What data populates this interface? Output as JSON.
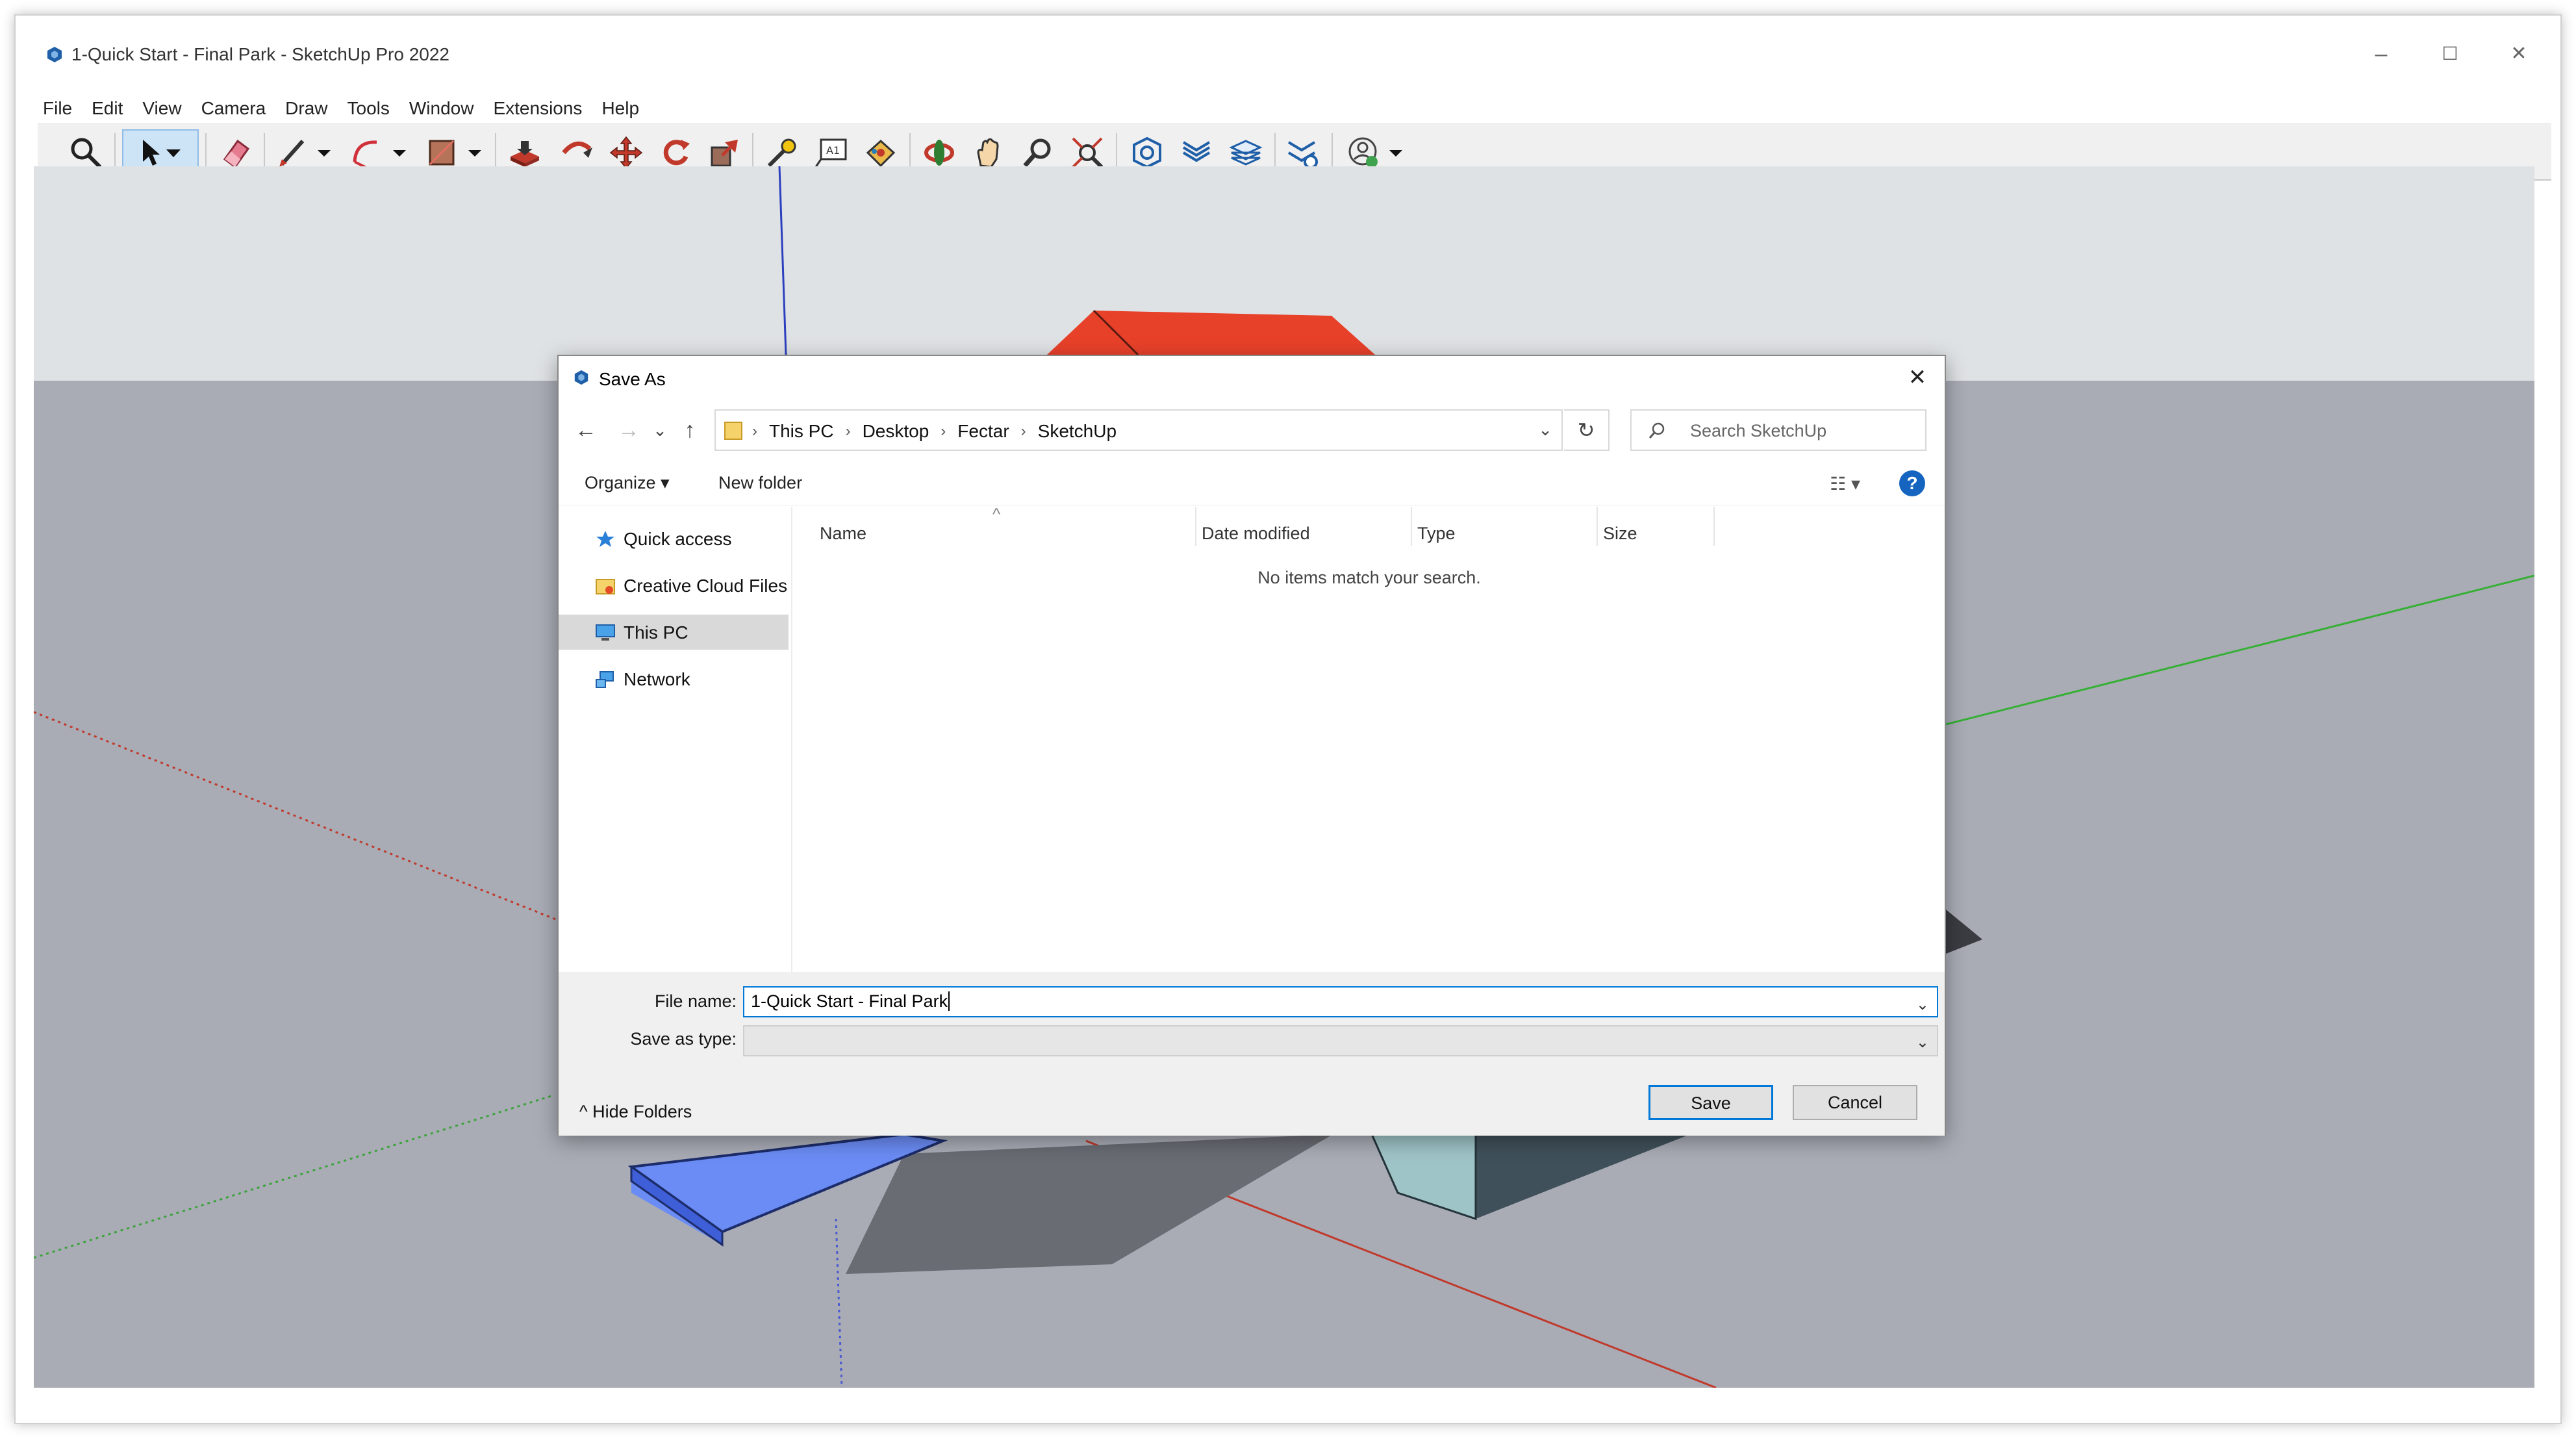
{
  "window": {
    "title": "1-Quick Start - Final Park - SketchUp Pro 2022",
    "controls": {
      "minimize": "–",
      "maximize": "☐",
      "close": "✕"
    }
  },
  "menubar": [
    "File",
    "Edit",
    "View",
    "Camera",
    "Draw",
    "Tools",
    "Window",
    "Extensions",
    "Help"
  ],
  "toolbar": {
    "tools": [
      "search-icon",
      "select-icon",
      "eraser-icon",
      "pencil-icon",
      "arc-icon",
      "rectangle-icon",
      "push-pull-icon",
      "follow-me-icon",
      "move-icon",
      "rotate-icon",
      "scale-icon",
      "tape-measure-icon",
      "text-icon",
      "paint-bucket-icon",
      "orbit-icon",
      "pan-icon",
      "zoom-icon",
      "zoom-extents-icon",
      "warehouse-icon",
      "extension-warehouse-icon",
      "layout-icon",
      "extension-manager-icon",
      "account-icon"
    ],
    "accent": "#cde4f7"
  },
  "dialog": {
    "title": "Save As",
    "close": "✕",
    "nav": {
      "back": "←",
      "forward": "→",
      "recent": "⌄",
      "up": "↑"
    },
    "breadcrumbs": [
      "This PC",
      "Desktop",
      "Fectar",
      "SketchUp"
    ],
    "breadcrumb_separator": "›",
    "address_dropdown": "⌄",
    "refresh": "↻",
    "search": {
      "placeholder": "Search SketchUp"
    },
    "commands": {
      "organize": "Organize ▾",
      "new_folder": "New folder",
      "view": "☷ ▾",
      "help": "?"
    },
    "nav_pane": [
      {
        "label": "Quick access",
        "icon": "star-icon"
      },
      {
        "label": "Creative Cloud Files",
        "icon": "creative-cloud-folder-icon"
      },
      {
        "label": "This PC",
        "icon": "computer-icon",
        "selected": true
      },
      {
        "label": "Network",
        "icon": "network-icon"
      }
    ],
    "columns": [
      "Name",
      "Date modified",
      "Type",
      "Size"
    ],
    "sort_indicator": "^",
    "empty_message": "No items match your search.",
    "file_name_label": "File name:",
    "file_name_value": "1-Quick Start - Final Park",
    "save_as_type_label": "Save as type:",
    "save_as_type_value": "",
    "dropdown_glyph": "⌄",
    "hide_folders": "^  Hide Folders",
    "buttons": {
      "save": "Save",
      "cancel": "Cancel"
    },
    "colors": {
      "primary_border": "#0078d7",
      "help": "#1565c0"
    }
  },
  "scene_colors": {
    "sky": "#dfe2e4",
    "ground": "#a9acb5",
    "roof": "#e8412a",
    "blue_slab": "#6b8cf5",
    "teal_block": "#9fc4c7"
  }
}
